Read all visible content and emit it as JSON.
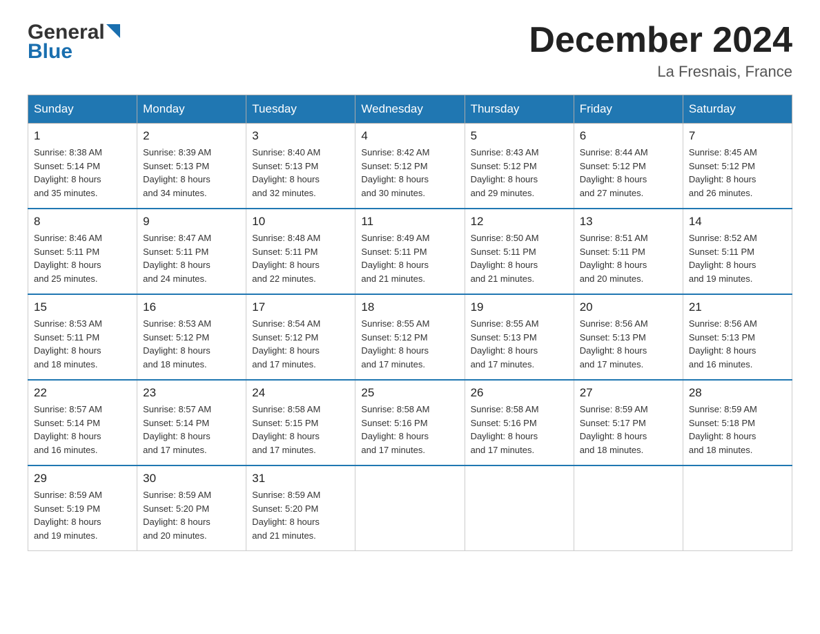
{
  "header": {
    "logo_general": "General",
    "logo_blue": "Blue",
    "month_title": "December 2024",
    "location": "La Fresnais, France"
  },
  "weekdays": [
    "Sunday",
    "Monday",
    "Tuesday",
    "Wednesday",
    "Thursday",
    "Friday",
    "Saturday"
  ],
  "weeks": [
    [
      {
        "day": "1",
        "sunrise": "8:38 AM",
        "sunset": "5:14 PM",
        "daylight": "8 hours and 35 minutes."
      },
      {
        "day": "2",
        "sunrise": "8:39 AM",
        "sunset": "5:13 PM",
        "daylight": "8 hours and 34 minutes."
      },
      {
        "day": "3",
        "sunrise": "8:40 AM",
        "sunset": "5:13 PM",
        "daylight": "8 hours and 32 minutes."
      },
      {
        "day": "4",
        "sunrise": "8:42 AM",
        "sunset": "5:12 PM",
        "daylight": "8 hours and 30 minutes."
      },
      {
        "day": "5",
        "sunrise": "8:43 AM",
        "sunset": "5:12 PM",
        "daylight": "8 hours and 29 minutes."
      },
      {
        "day": "6",
        "sunrise": "8:44 AM",
        "sunset": "5:12 PM",
        "daylight": "8 hours and 27 minutes."
      },
      {
        "day": "7",
        "sunrise": "8:45 AM",
        "sunset": "5:12 PM",
        "daylight": "8 hours and 26 minutes."
      }
    ],
    [
      {
        "day": "8",
        "sunrise": "8:46 AM",
        "sunset": "5:11 PM",
        "daylight": "8 hours and 25 minutes."
      },
      {
        "day": "9",
        "sunrise": "8:47 AM",
        "sunset": "5:11 PM",
        "daylight": "8 hours and 24 minutes."
      },
      {
        "day": "10",
        "sunrise": "8:48 AM",
        "sunset": "5:11 PM",
        "daylight": "8 hours and 22 minutes."
      },
      {
        "day": "11",
        "sunrise": "8:49 AM",
        "sunset": "5:11 PM",
        "daylight": "8 hours and 21 minutes."
      },
      {
        "day": "12",
        "sunrise": "8:50 AM",
        "sunset": "5:11 PM",
        "daylight": "8 hours and 21 minutes."
      },
      {
        "day": "13",
        "sunrise": "8:51 AM",
        "sunset": "5:11 PM",
        "daylight": "8 hours and 20 minutes."
      },
      {
        "day": "14",
        "sunrise": "8:52 AM",
        "sunset": "5:11 PM",
        "daylight": "8 hours and 19 minutes."
      }
    ],
    [
      {
        "day": "15",
        "sunrise": "8:53 AM",
        "sunset": "5:11 PM",
        "daylight": "8 hours and 18 minutes."
      },
      {
        "day": "16",
        "sunrise": "8:53 AM",
        "sunset": "5:12 PM",
        "daylight": "8 hours and 18 minutes."
      },
      {
        "day": "17",
        "sunrise": "8:54 AM",
        "sunset": "5:12 PM",
        "daylight": "8 hours and 17 minutes."
      },
      {
        "day": "18",
        "sunrise": "8:55 AM",
        "sunset": "5:12 PM",
        "daylight": "8 hours and 17 minutes."
      },
      {
        "day": "19",
        "sunrise": "8:55 AM",
        "sunset": "5:13 PM",
        "daylight": "8 hours and 17 minutes."
      },
      {
        "day": "20",
        "sunrise": "8:56 AM",
        "sunset": "5:13 PM",
        "daylight": "8 hours and 17 minutes."
      },
      {
        "day": "21",
        "sunrise": "8:56 AM",
        "sunset": "5:13 PM",
        "daylight": "8 hours and 16 minutes."
      }
    ],
    [
      {
        "day": "22",
        "sunrise": "8:57 AM",
        "sunset": "5:14 PM",
        "daylight": "8 hours and 16 minutes."
      },
      {
        "day": "23",
        "sunrise": "8:57 AM",
        "sunset": "5:14 PM",
        "daylight": "8 hours and 17 minutes."
      },
      {
        "day": "24",
        "sunrise": "8:58 AM",
        "sunset": "5:15 PM",
        "daylight": "8 hours and 17 minutes."
      },
      {
        "day": "25",
        "sunrise": "8:58 AM",
        "sunset": "5:16 PM",
        "daylight": "8 hours and 17 minutes."
      },
      {
        "day": "26",
        "sunrise": "8:58 AM",
        "sunset": "5:16 PM",
        "daylight": "8 hours and 17 minutes."
      },
      {
        "day": "27",
        "sunrise": "8:59 AM",
        "sunset": "5:17 PM",
        "daylight": "8 hours and 18 minutes."
      },
      {
        "day": "28",
        "sunrise": "8:59 AM",
        "sunset": "5:18 PM",
        "daylight": "8 hours and 18 minutes."
      }
    ],
    [
      {
        "day": "29",
        "sunrise": "8:59 AM",
        "sunset": "5:19 PM",
        "daylight": "8 hours and 19 minutes."
      },
      {
        "day": "30",
        "sunrise": "8:59 AM",
        "sunset": "5:20 PM",
        "daylight": "8 hours and 20 minutes."
      },
      {
        "day": "31",
        "sunrise": "8:59 AM",
        "sunset": "5:20 PM",
        "daylight": "8 hours and 21 minutes."
      },
      null,
      null,
      null,
      null
    ]
  ],
  "labels": {
    "sunrise": "Sunrise:",
    "sunset": "Sunset:",
    "daylight": "Daylight:"
  }
}
